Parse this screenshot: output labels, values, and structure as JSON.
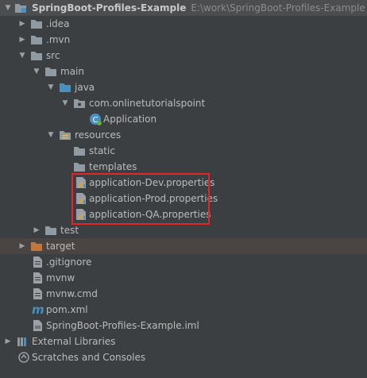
{
  "project": {
    "name": "SpringBoot-Profiles-Example",
    "path": "E:\\work\\SpringBoot-Profiles-Example"
  },
  "tree": {
    "idea": ".idea",
    "mvn": ".mvn",
    "src": "src",
    "main": "main",
    "java": "java",
    "package": "com.onlinetutorialspoint",
    "application": "Application",
    "resources": "resources",
    "static": "static",
    "templates": "templates",
    "props_dev": "application-Dev.properties",
    "props_prod": "application-Prod.properties",
    "props_qa": "application-QA.properties",
    "test": "test",
    "target": "target",
    "gitignore": ".gitignore",
    "mvnw": "mvnw",
    "mvnw_cmd": "mvnw.cmd",
    "pom": "pom.xml",
    "iml": "SpringBoot-Profiles-Example.iml",
    "external_libraries": "External Libraries",
    "scratches": "Scratches and Consoles"
  },
  "colors": {
    "background": "#3c3f41",
    "text": "#bbbbbb",
    "folder": "#8f9aa3",
    "source_folder": "#4a8fc1",
    "excluded_folder": "#c57538",
    "highlight_border": "#e0252b"
  }
}
